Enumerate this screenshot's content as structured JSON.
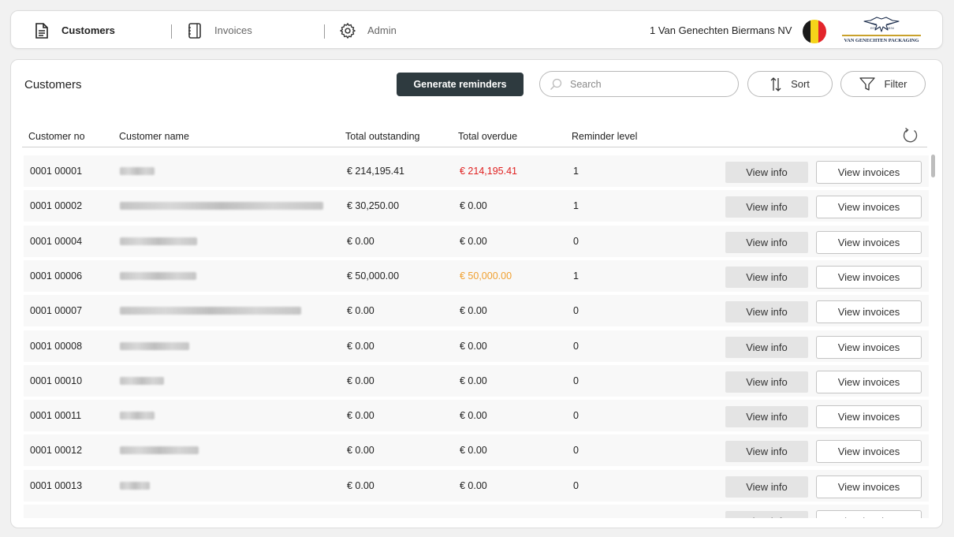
{
  "nav": {
    "items": [
      {
        "label": "Customers",
        "icon": "document-icon"
      },
      {
        "label": "Invoices",
        "icon": "notebook-icon"
      },
      {
        "label": "Admin",
        "icon": "gear-icon"
      }
    ],
    "company": "1 Van Genechten Biermans NV",
    "flag_colors": [
      "#1a1a1a",
      "#f5d41a",
      "#e3252b"
    ],
    "logo_text": "VAN GENECHTEN PACKAGING"
  },
  "page": {
    "title": "Customers",
    "generate_label": "Generate reminders",
    "search_placeholder": "Search",
    "sort_label": "Sort",
    "filter_label": "Filter"
  },
  "table": {
    "headers": {
      "customer_no": "Customer no",
      "customer_name": "Customer name",
      "total_outstanding": "Total outstanding",
      "total_overdue": "Total overdue",
      "reminder_level": "Reminder level"
    },
    "view_info_label": "View info",
    "view_invoices_label": "View invoices",
    "overdue_colors": {
      "red": "#e02020",
      "orange": "#f0a030"
    },
    "rows": [
      {
        "no": "0001 00001",
        "outstanding": "€ 214,195.41",
        "overdue": "€ 214,195.41",
        "overdue_color": "red",
        "level": "1"
      },
      {
        "no": "0001 00002",
        "outstanding": "€ 30,250.00",
        "overdue": "€ 0.00",
        "overdue_color": "",
        "level": "1"
      },
      {
        "no": "0001 00004",
        "outstanding": "€ 0.00",
        "overdue": "€ 0.00",
        "overdue_color": "",
        "level": "0"
      },
      {
        "no": "0001 00006",
        "outstanding": "€ 50,000.00",
        "overdue": "€ 50,000.00",
        "overdue_color": "orange",
        "level": "1"
      },
      {
        "no": "0001 00007",
        "outstanding": "€ 0.00",
        "overdue": "€ 0.00",
        "overdue_color": "",
        "level": "0"
      },
      {
        "no": "0001 00008",
        "outstanding": "€ 0.00",
        "overdue": "€ 0.00",
        "overdue_color": "",
        "level": "0"
      },
      {
        "no": "0001 00010",
        "outstanding": "€ 0.00",
        "overdue": "€ 0.00",
        "overdue_color": "",
        "level": "0"
      },
      {
        "no": "0001 00011",
        "outstanding": "€ 0.00",
        "overdue": "€ 0.00",
        "overdue_color": "",
        "level": "0"
      },
      {
        "no": "0001 00012",
        "outstanding": "€ 0.00",
        "overdue": "€ 0.00",
        "overdue_color": "",
        "level": "0"
      },
      {
        "no": "0001 00013",
        "outstanding": "€ 0.00",
        "overdue": "€ 0.00",
        "overdue_color": "",
        "level": "0"
      },
      {
        "no": "",
        "outstanding": "",
        "overdue": "",
        "overdue_color": "",
        "level": ""
      }
    ]
  }
}
